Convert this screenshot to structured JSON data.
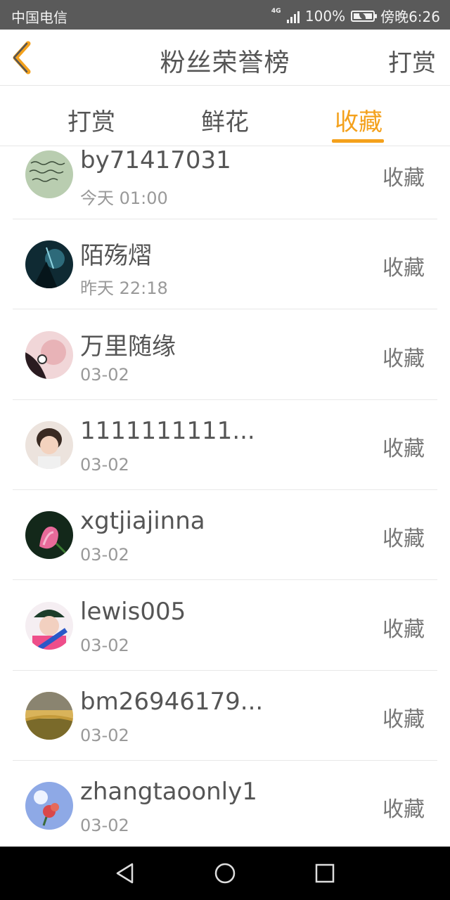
{
  "status_bar": {
    "carrier": "中国电信",
    "network": "4G",
    "battery": "100%",
    "time": "傍晚6:26"
  },
  "header": {
    "title": "粉丝荣誉榜",
    "right_action": "打赏",
    "back_icon": "chevron-left-icon"
  },
  "tabs": [
    {
      "label": "打赏",
      "active": false
    },
    {
      "label": "鲜花",
      "active": false
    },
    {
      "label": "收藏",
      "active": true
    }
  ],
  "colors": {
    "accent": "#f4a11c",
    "status_bar": "#5a5a5a",
    "nav_bar": "#000000"
  },
  "list": [
    {
      "name": "by71417031",
      "time": "今天 01:00",
      "action": "收藏",
      "avatar": "handwriting-avatar"
    },
    {
      "name": "陌殇熠",
      "time": "昨天 22:18",
      "action": "收藏",
      "avatar": "anime-dark-avatar"
    },
    {
      "name": "万里随缘",
      "time": "03-02",
      "action": "收藏",
      "avatar": "anime-pink-avatar"
    },
    {
      "name": "1111111111...",
      "time": "03-02",
      "action": "收藏",
      "avatar": "child-photo-avatar"
    },
    {
      "name": "xgtjiajinna",
      "time": "03-02",
      "action": "收藏",
      "avatar": "pink-flower-avatar"
    },
    {
      "name": "lewis005",
      "time": "03-02",
      "action": "收藏",
      "avatar": "person-cap-avatar"
    },
    {
      "name": "bm26946179...",
      "time": "03-02",
      "action": "收藏",
      "avatar": "landscape-avatar"
    },
    {
      "name": "zhangtaoonly1",
      "time": "03-02",
      "action": "收藏",
      "avatar": "sky-flower-avatar"
    }
  ],
  "nav_bar": {
    "back": "triangle-back-icon",
    "home": "circle-home-icon",
    "recents": "square-recents-icon"
  }
}
